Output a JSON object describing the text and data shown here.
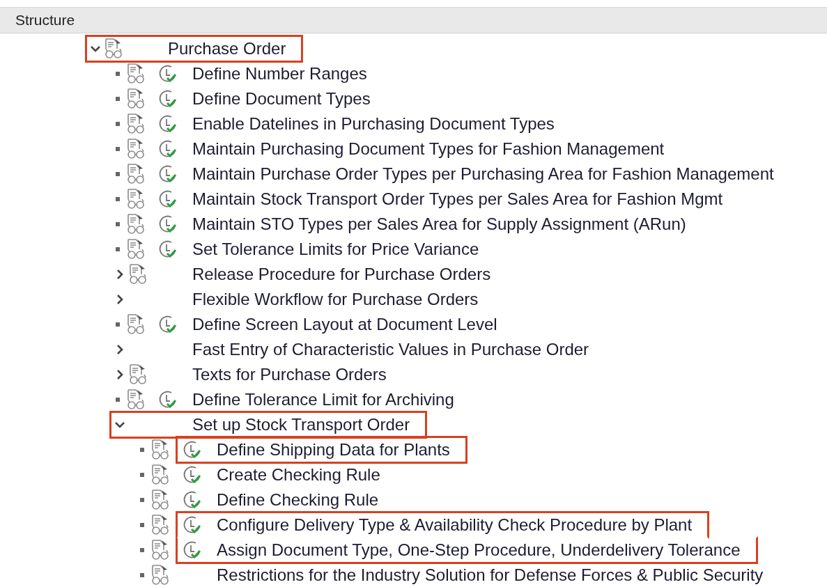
{
  "header": {
    "title": "Structure"
  },
  "tree": [
    {
      "label": "Purchase Order",
      "kind": "node",
      "expanded": true,
      "documentation": true,
      "activity": false,
      "highlighted": true,
      "children": [
        {
          "label": "Define Number Ranges",
          "kind": "leaf",
          "documentation": true,
          "activity": true,
          "highlighted": false
        },
        {
          "label": "Define Document Types",
          "kind": "leaf",
          "documentation": true,
          "activity": true,
          "highlighted": false
        },
        {
          "label": "Enable Datelines in Purchasing Document Types",
          "kind": "leaf",
          "documentation": true,
          "activity": true,
          "highlighted": false
        },
        {
          "label": "Maintain Purchasing Document Types for Fashion Management",
          "kind": "leaf",
          "documentation": true,
          "activity": true,
          "highlighted": false
        },
        {
          "label": "Maintain Purchase Order Types per Purchasing Area for Fashion Management",
          "kind": "leaf",
          "documentation": true,
          "activity": true,
          "highlighted": false
        },
        {
          "label": "Maintain Stock Transport Order Types per Sales Area for Fashion Mgmt",
          "kind": "leaf",
          "documentation": true,
          "activity": true,
          "highlighted": false
        },
        {
          "label": "Maintain STO Types per Sales Area for Supply Assignment (ARun)",
          "kind": "leaf",
          "documentation": true,
          "activity": true,
          "highlighted": false
        },
        {
          "label": "Set Tolerance Limits for Price Variance",
          "kind": "leaf",
          "documentation": true,
          "activity": true,
          "highlighted": false
        },
        {
          "label": "Release Procedure for Purchase Orders",
          "kind": "node",
          "expanded": false,
          "documentation": true,
          "activity": false,
          "highlighted": false
        },
        {
          "label": "Flexible Workflow for Purchase Orders",
          "kind": "node",
          "expanded": false,
          "documentation": false,
          "activity": false,
          "highlighted": false
        },
        {
          "label": "Define Screen Layout at Document Level",
          "kind": "leaf",
          "documentation": true,
          "activity": true,
          "highlighted": false
        },
        {
          "label": "Fast Entry of Characteristic Values in Purchase Order",
          "kind": "node",
          "expanded": false,
          "documentation": false,
          "activity": false,
          "highlighted": false
        },
        {
          "label": "Texts for Purchase Orders",
          "kind": "node",
          "expanded": false,
          "documentation": true,
          "activity": false,
          "highlighted": false
        },
        {
          "label": "Define Tolerance Limit for Archiving",
          "kind": "leaf",
          "documentation": true,
          "activity": true,
          "highlighted": false
        },
        {
          "label": "Set up Stock Transport Order",
          "kind": "node",
          "expanded": true,
          "documentation": false,
          "activity": false,
          "highlighted": true,
          "children": [
            {
              "label": "Define Shipping Data for Plants",
              "kind": "leaf",
              "documentation": true,
              "activity": true,
              "highlighted": true
            },
            {
              "label": "Create Checking Rule",
              "kind": "leaf",
              "documentation": true,
              "activity": true,
              "highlighted": false
            },
            {
              "label": "Define Checking Rule",
              "kind": "leaf",
              "documentation": true,
              "activity": true,
              "highlighted": false
            },
            {
              "label": "Configure Delivery Type & Availability Check Procedure by Plant",
              "kind": "leaf",
              "documentation": true,
              "activity": true,
              "highlighted": true
            },
            {
              "label": "Assign Document Type, One-Step Procedure, Underdelivery Tolerance",
              "kind": "leaf",
              "documentation": true,
              "activity": true,
              "highlighted": true
            },
            {
              "label": "Restrictions for the Industry Solution for Defense Forces & Public Security",
              "kind": "leaf",
              "documentation": true,
              "activity": false,
              "highlighted": false
            }
          ]
        }
      ]
    }
  ]
}
